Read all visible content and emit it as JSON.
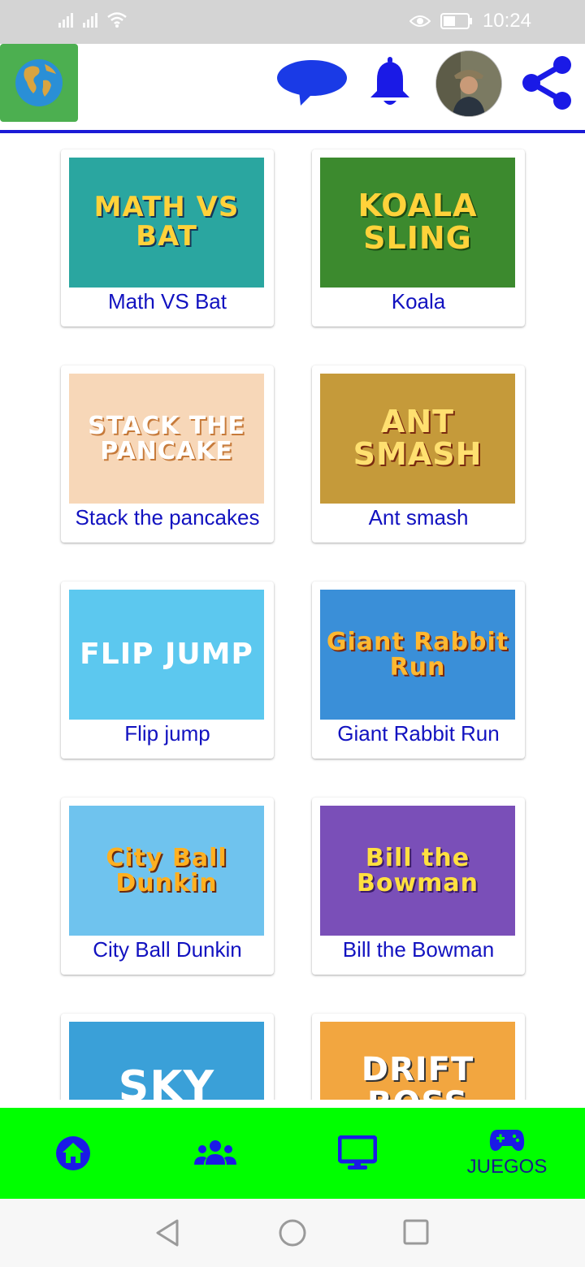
{
  "status_bar": {
    "time": "10:24"
  },
  "colors": {
    "header_accent": "#1a1ad6",
    "label_color": "#1212c0",
    "bottom_nav_bg": "#00ff00",
    "icon_blue": "#1a1ae6",
    "globe_bg": "#4caf50"
  },
  "header": {
    "icons": [
      "globe-icon",
      "chat-icon",
      "bell-icon",
      "avatar",
      "share-icon"
    ]
  },
  "games": [
    {
      "label": "Math VS Bat",
      "thumb_text": "MATH VS BAT",
      "bg": "#2aa6a0",
      "fg": "#ffd23a"
    },
    {
      "label": "Koala",
      "thumb_text": "KOALA SLING",
      "bg": "#3c8a2e",
      "fg": "#ffd23a"
    },
    {
      "label": "Stack the pancakes",
      "thumb_text": "STACK THE PANCAKE",
      "bg": "#f7d7b8",
      "fg": "#ffffff"
    },
    {
      "label": "Ant smash",
      "thumb_text": "ANT SMASH",
      "bg": "#c59a3a",
      "fg": "#ffe070"
    },
    {
      "label": "Flip jump",
      "thumb_text": "FLIP JUMP",
      "bg": "#5cc8ef",
      "fg": "#ffffff"
    },
    {
      "label": "Giant Rabbit Run",
      "thumb_text": "Giant Rabbit Run",
      "bg": "#3a8fd8",
      "fg": "#ffb830"
    },
    {
      "label": "City Ball Dunkin",
      "thumb_text": "City Ball Dunkin",
      "bg": "#6fc3ee",
      "fg": "#ffb020"
    },
    {
      "label": "Bill the Bowman",
      "thumb_text": "Bill the Bowman",
      "bg": "#7a4fb8",
      "fg": "#ffe040"
    },
    {
      "label": "",
      "thumb_text": "SKY",
      "bg": "#3aa0d8",
      "fg": "#ffffff"
    },
    {
      "label": "",
      "thumb_text": "DRIFT BOSS",
      "bg": "#f2a640",
      "fg": "#ffffff"
    }
  ],
  "bottom_nav": {
    "items": [
      {
        "icon": "home-icon"
      },
      {
        "icon": "users-icon"
      },
      {
        "icon": "monitor-icon"
      },
      {
        "icon": "gamepad-icon",
        "label": "JUEGOS"
      }
    ]
  },
  "system_nav": {
    "icons": [
      "back-icon",
      "home-circle-icon",
      "recents-icon"
    ]
  }
}
